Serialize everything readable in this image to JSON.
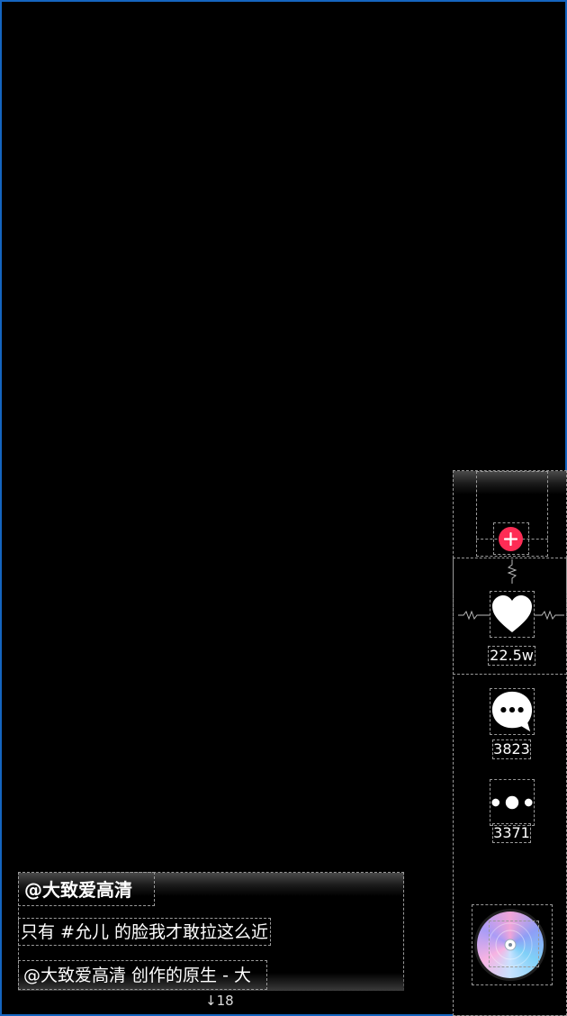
{
  "video": {
    "author": "@大致爱高清",
    "description": "只有 #允儿 的脸我才敢拉这么近",
    "music": "@大致爱高清 创作的原生 - 大",
    "bottom_counter": "18"
  },
  "actions": {
    "likes": "22.5w",
    "comments": "3823",
    "shares": "3371"
  },
  "colors": {
    "follow": "#fe2c55",
    "frame": "#1565c0",
    "background": "#000000"
  },
  "icons": [
    "plus-icon",
    "heart-icon",
    "comment-icon",
    "more-icon",
    "music-disc-icon",
    "down-arrow-icon"
  ]
}
